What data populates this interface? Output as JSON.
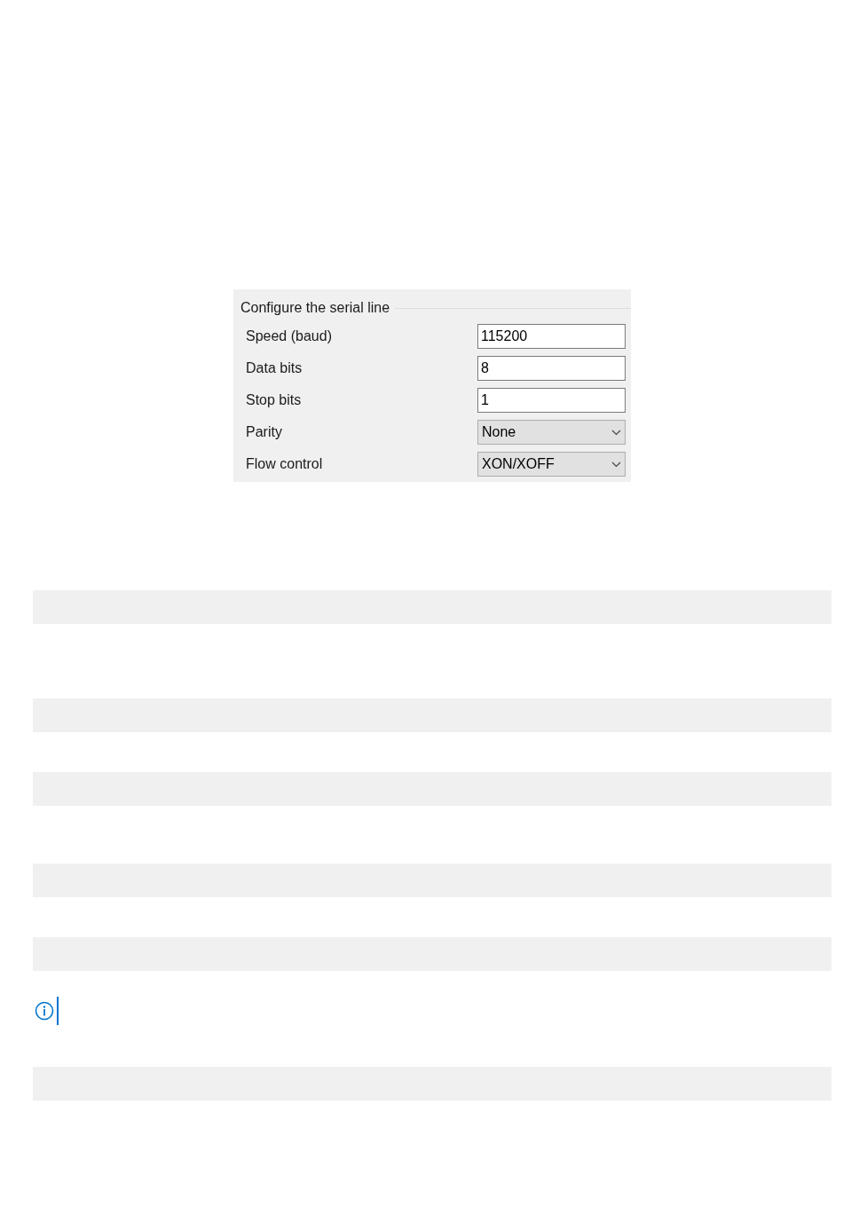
{
  "serial_panel": {
    "title": "Configure the serial line",
    "fields": [
      {
        "label": "Speed (baud)",
        "kind": "text",
        "value": "115200"
      },
      {
        "label": "Data bits",
        "kind": "text",
        "value": "8"
      },
      {
        "label": "Stop bits",
        "kind": "text",
        "value": "1"
      },
      {
        "label": "Parity",
        "kind": "select",
        "value": "None"
      },
      {
        "label": "Flow control",
        "kind": "select",
        "value": "XON/XOFF"
      }
    ]
  }
}
